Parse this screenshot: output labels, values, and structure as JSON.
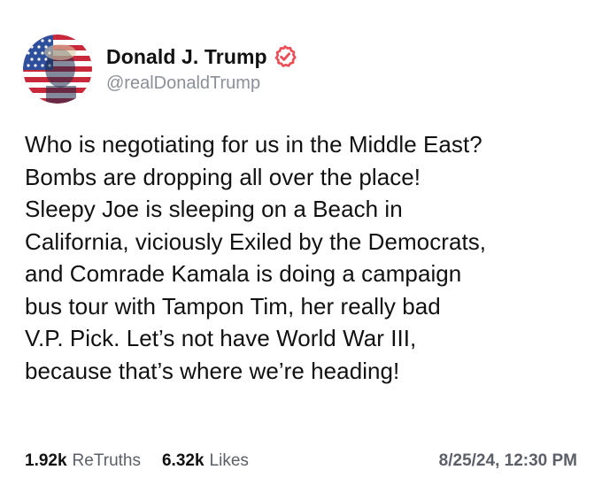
{
  "author": {
    "display_name": "Donald J. Trump",
    "handle": "@realDonaldTrump",
    "avatar_icon": "avatar-flag-portrait",
    "verified_icon": "verified-badge-icon",
    "verified_color": "#ee4b55"
  },
  "post": {
    "text": "Who is negotiating for us in the Middle East?\nBombs are dropping all over the place!\nSleepy Joe is sleeping on a Beach in\nCalifornia, viciously Exiled by the Democrats,\nand Comrade Kamala is doing a campaign\nbus tour with Tampon Tim, her really bad\nV.P. Pick. Let’s not have World War III,\nbecause that’s where we’re heading!"
  },
  "stats": {
    "retruths_count": "1.92k",
    "retruths_label": "ReTruths",
    "likes_count": "6.32k",
    "likes_label": "Likes",
    "timestamp": "8/25/24, 12:30 PM"
  },
  "colors": {
    "text_primary": "#111111",
    "text_secondary": "#5b6068",
    "handle": "#8a8f98",
    "background": "#ffffff"
  }
}
